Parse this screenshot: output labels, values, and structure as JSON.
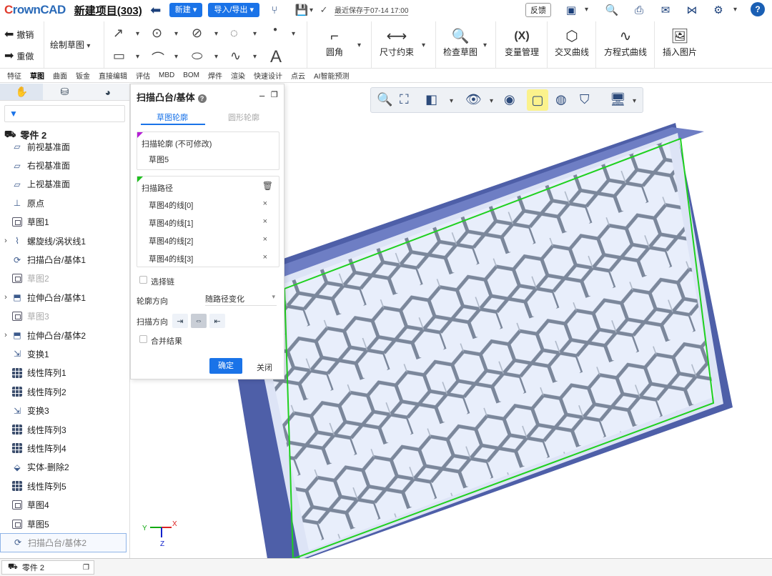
{
  "app": {
    "logo": "CrownCAD",
    "project_title": "新建项目(303)",
    "new_button": "新建",
    "import_export_button": "导入/导出",
    "save_status": "最近保存于07-14 17:00",
    "feedback": "反馈"
  },
  "ribbon": {
    "undo": "撤销",
    "redo": "重做",
    "draw_sketch": "绘制草图",
    "fillet": "圆角",
    "dimension": "尺寸约束",
    "check_sketch": "检查草图",
    "variables": "变量管理",
    "variables_icon_text": "(X)",
    "intersection_curve": "交叉曲线",
    "equation_curve": "方程式曲线",
    "insert_image": "插入图片",
    "text_tool_glyph": "A"
  },
  "tabs": [
    "特征",
    "草图",
    "曲面",
    "钣金",
    "直接编辑",
    "评估",
    "MBD",
    "BOM",
    "焊件",
    "渲染",
    "快速设计",
    "点云",
    "AI智能预测"
  ],
  "active_tab": "草图",
  "tree": {
    "root": "零件 2",
    "items": [
      {
        "label": "前视基准面",
        "icon": "plane",
        "exp": "",
        "state": ""
      },
      {
        "label": "右视基准面",
        "icon": "plane",
        "exp": "",
        "state": ""
      },
      {
        "label": "上视基准面",
        "icon": "plane",
        "exp": "",
        "state": ""
      },
      {
        "label": "原点",
        "icon": "origin",
        "exp": "",
        "state": ""
      },
      {
        "label": "草图1",
        "icon": "sketch",
        "exp": "",
        "state": ""
      },
      {
        "label": "螺旋线/涡状线1",
        "icon": "helix",
        "exp": "›",
        "state": ""
      },
      {
        "label": "扫描凸台/基体1",
        "icon": "sweep",
        "exp": "",
        "state": ""
      },
      {
        "label": "草图2",
        "icon": "sketch",
        "exp": "",
        "state": "dim"
      },
      {
        "label": "拉伸凸台/基体1",
        "icon": "extrude",
        "exp": "›",
        "state": ""
      },
      {
        "label": "草图3",
        "icon": "sketch",
        "exp": "",
        "state": "dim"
      },
      {
        "label": "拉伸凸台/基体2",
        "icon": "extrude",
        "exp": "›",
        "state": ""
      },
      {
        "label": "变换1",
        "icon": "transform",
        "exp": "",
        "state": ""
      },
      {
        "label": "线性阵列1",
        "icon": "grid",
        "exp": "",
        "state": ""
      },
      {
        "label": "线性阵列2",
        "icon": "grid",
        "exp": "",
        "state": ""
      },
      {
        "label": "变换3",
        "icon": "transform",
        "exp": "",
        "state": ""
      },
      {
        "label": "线性阵列3",
        "icon": "grid",
        "exp": "",
        "state": ""
      },
      {
        "label": "线性阵列4",
        "icon": "grid",
        "exp": "",
        "state": ""
      },
      {
        "label": "实体-删除2",
        "icon": "delete",
        "exp": "",
        "state": ""
      },
      {
        "label": "线性阵列5",
        "icon": "grid",
        "exp": "",
        "state": ""
      },
      {
        "label": "草图4",
        "icon": "sketch",
        "exp": "",
        "state": ""
      },
      {
        "label": "草图5",
        "icon": "sketch",
        "exp": "",
        "state": ""
      },
      {
        "label": "扫描凸台/基体2",
        "icon": "sweep",
        "exp": "",
        "state": "sel"
      }
    ]
  },
  "bottom_tab": "零件 2",
  "dialog": {
    "title": "扫描凸台/基体",
    "tab_sketch_profile": "草图轮廓",
    "tab_circle_profile": "圆形轮廓",
    "profile_label": "扫描轮廓 (不可修改)",
    "profile_value": "草图5",
    "path_label": "扫描路径",
    "path_items": [
      "草图4的线[0]",
      "草图4的线[1]",
      "草图4的线[2]",
      "草图4的线[3]"
    ],
    "remove_glyph": "×",
    "select_chain": "选择链",
    "profile_direction_label": "轮廓方向",
    "profile_direction_value": "随路径变化",
    "sweep_direction_label": "扫描方向",
    "merge_result": "合并结果",
    "ok": "确定",
    "close": "关闭"
  },
  "triad": {
    "x": "X",
    "y": "Y",
    "z": "Z"
  },
  "colors": {
    "accent": "#1a73e8",
    "frame_blue": "#4e5fa8",
    "mesh_fill": "#dde4f6",
    "highlight_green": "#1fd11f"
  }
}
